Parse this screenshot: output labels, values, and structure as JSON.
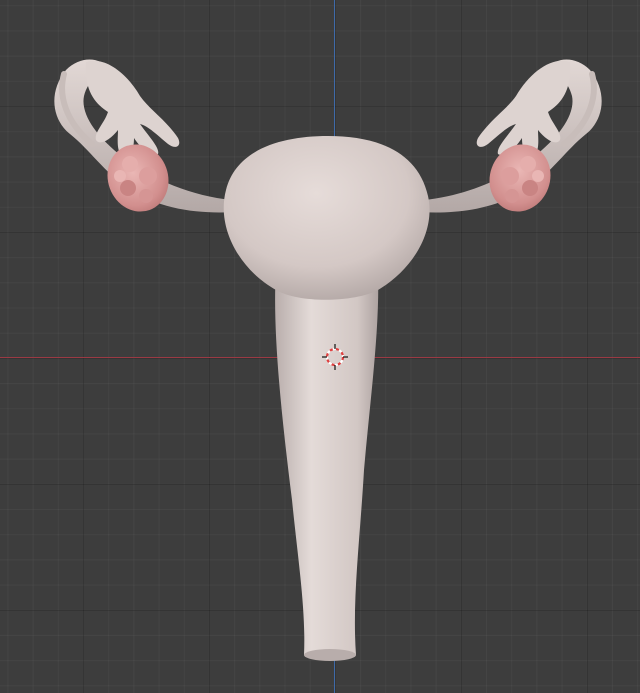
{
  "viewport": {
    "background": "#3d3d3d",
    "x_axis_color": "#9b3a44",
    "y_axis_color": "#3f6aa8"
  },
  "model": {
    "name": "uterus-anatomy-model",
    "surface_color": "#d6cbc8",
    "shadow_color": "#a99e9c",
    "ovary_color": "#d79a9a"
  },
  "cursor": {
    "icon": "3d-cursor-icon",
    "ring_color_a": "#e04040",
    "ring_color_b": "#ffffff"
  }
}
